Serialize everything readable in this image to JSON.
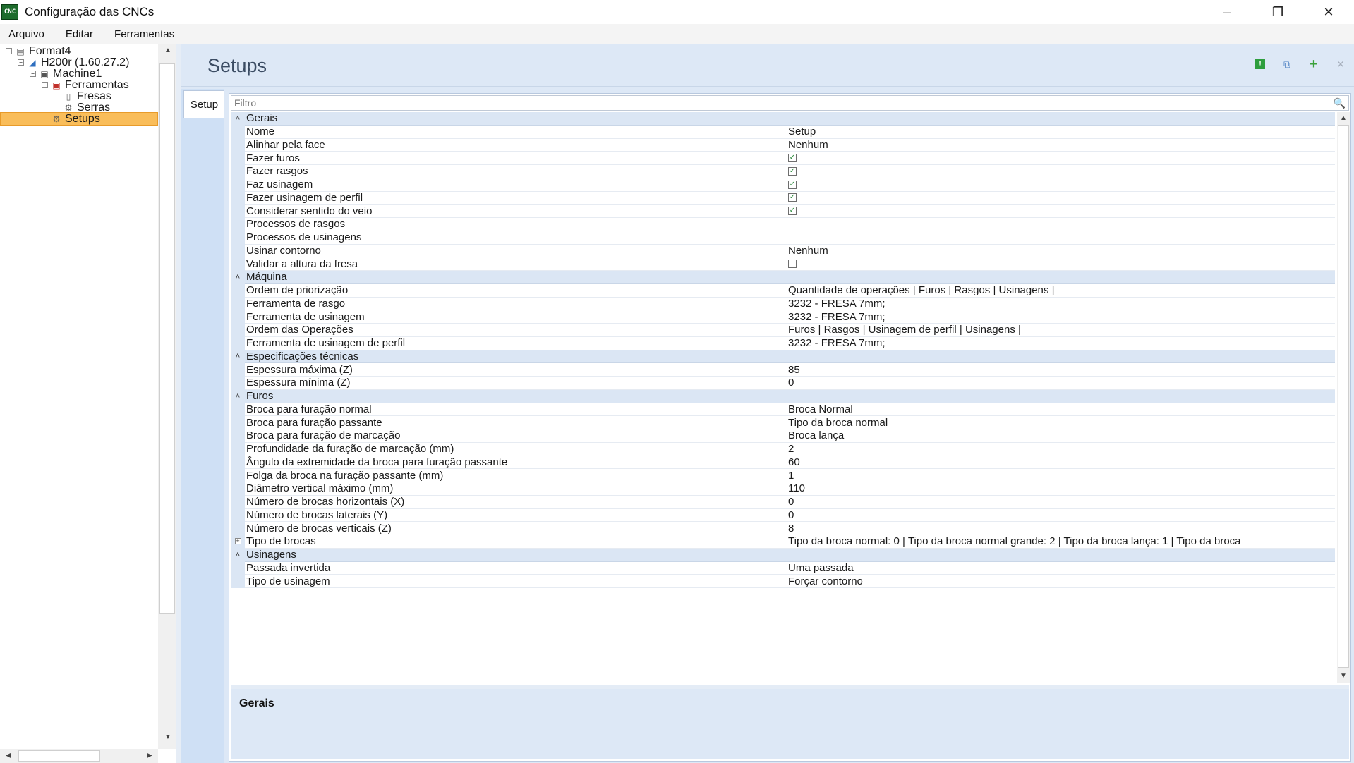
{
  "window": {
    "title": "Configuração das CNCs",
    "icon_text": "CNC"
  },
  "menu": [
    "Arquivo",
    "Editar",
    "Ferramentas"
  ],
  "tree": [
    {
      "label": "Format4",
      "level": 0,
      "icon": "machine-icon",
      "expander": "⊟"
    },
    {
      "label": "H200r (1.60.27.2)",
      "level": 1,
      "icon": "cnc-icon",
      "expander": "⊟"
    },
    {
      "label": "Machine1",
      "level": 2,
      "icon": "machine-unit-icon",
      "expander": "⊟"
    },
    {
      "label": "Ferramentas",
      "level": 3,
      "icon": "toolbox-icon",
      "expander": "⊟"
    },
    {
      "label": "Fresas",
      "level": 4,
      "icon": "mill-icon",
      "expander": ""
    },
    {
      "label": "Serras",
      "level": 4,
      "icon": "saw-icon",
      "expander": ""
    },
    {
      "label": "Setups",
      "level": 3,
      "icon": "gear-icon",
      "expander": "",
      "selected": true
    }
  ],
  "page": {
    "title": "Setups",
    "tab": "Setup"
  },
  "filter": {
    "placeholder": "Filtro"
  },
  "grid": [
    {
      "type": "category",
      "label": "Gerais"
    },
    {
      "label": "Nome",
      "value": "Setup"
    },
    {
      "label": "Alinhar pela face",
      "value": "Nenhum"
    },
    {
      "label": "Fazer furos",
      "check": true
    },
    {
      "label": "Fazer rasgos",
      "check": true
    },
    {
      "label": "Faz usinagem",
      "check": true
    },
    {
      "label": "Fazer usinagem de perfil",
      "check": true
    },
    {
      "label": "Considerar sentido do veio",
      "check": true
    },
    {
      "label": "Processos de rasgos",
      "value": ""
    },
    {
      "label": "Processos de usinagens",
      "value": ""
    },
    {
      "label": "Usinar contorno",
      "value": "Nenhum"
    },
    {
      "label": "Validar a altura da fresa",
      "check": false
    },
    {
      "type": "category",
      "label": "Máquina"
    },
    {
      "label": "Ordem de priorização",
      "value": "Quantidade de operações | Furos | Rasgos | Usinagens |"
    },
    {
      "label": "Ferramenta de rasgo",
      "value": "3232 - FRESA 7mm;"
    },
    {
      "label": "Ferramenta de usinagem",
      "value": "3232 - FRESA 7mm;"
    },
    {
      "label": "Ordem das Operações",
      "value": "Furos | Rasgos | Usinagem de perfil | Usinagens |"
    },
    {
      "label": "Ferramenta de usinagem de perfil",
      "value": "3232 - FRESA 7mm;"
    },
    {
      "type": "category",
      "label": "Especificações técnicas"
    },
    {
      "label": "Espessura máxima (Z)",
      "value": "85"
    },
    {
      "label": "Espessura mínima (Z)",
      "value": "0"
    },
    {
      "type": "category",
      "label": "Furos"
    },
    {
      "label": "Broca para furação normal",
      "value": "Broca Normal"
    },
    {
      "label": "Broca para furação passante",
      "value": "Tipo da broca normal"
    },
    {
      "label": "Broca para furação de marcação",
      "value": "Broca lança"
    },
    {
      "label": "Profundidade da furação de marcação (mm)",
      "value": "2"
    },
    {
      "label": "Ângulo da extremidade da broca para furação passante",
      "value": "60"
    },
    {
      "label": "Folga da broca na furação passante (mm)",
      "value": "1"
    },
    {
      "label": "Diâmetro vertical máximo (mm)",
      "value": "110"
    },
    {
      "label": "Número de brocas horizontais (X)",
      "value": "0"
    },
    {
      "label": "Número de brocas laterais (Y)",
      "value": "0"
    },
    {
      "label": "Número de brocas verticais (Z)",
      "value": "8"
    },
    {
      "label": "Tipo de brocas",
      "value": "Tipo da broca normal: 0  |  Tipo da broca normal grande: 2  |  Tipo da broca lança: 1  |  Tipo da broca",
      "expandable": true
    },
    {
      "type": "category",
      "label": "Usinagens"
    },
    {
      "label": "Passada invertida",
      "value": "Uma passada"
    },
    {
      "label": "Tipo de usinagem",
      "value": "Forçar contorno"
    }
  ],
  "description": {
    "title": "Gerais"
  },
  "colors": {
    "selection": "#f9bd5a",
    "category_bg": "#dbe6f4",
    "panel_bg": "#dde8f6",
    "accent_green": "#3aa13a"
  }
}
